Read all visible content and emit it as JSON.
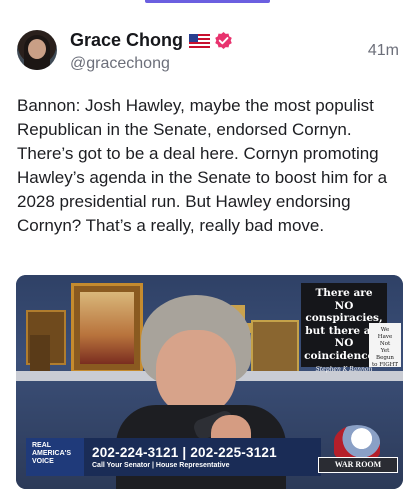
{
  "post": {
    "author_name": "Grace Chong",
    "handle": "@gracechong",
    "timestamp": "41m",
    "text": "Bannon: Josh Hawley, maybe the most populist Republican in the Senate, endorsed Cornyn. There’s got to be a deal here. Cornyn promoting Hawley’s agenda in the Senate to boost him for a 2028 presidential run. But Hawley endorsing Cornyn? That’s a really, really bad move."
  },
  "media": {
    "sign_text": [
      "There are",
      "NO",
      "conspiracies,",
      "but there are",
      "NO",
      "coincidences."
    ],
    "sign_signature": "Stephen K Bannon",
    "small_sign_text": [
      "We",
      "Have",
      "Not",
      "Yet",
      "Begun",
      "to FIGHT"
    ],
    "banner_logo_text": [
      "REAL",
      "AMERICA'S",
      "VOICE"
    ],
    "banner_phone": "202-224-3121 | 202-225-3121",
    "banner_subtext": "Call Your Senator | House Representative",
    "show_logo_text": "WAR ROOM"
  },
  "icons": {
    "flag": "us-flag-icon",
    "verified": "verified-badge-icon"
  },
  "colors": {
    "accent": "#6b5fe0",
    "verified": "#e8336e",
    "secondary_text": "#6c6f7a"
  }
}
